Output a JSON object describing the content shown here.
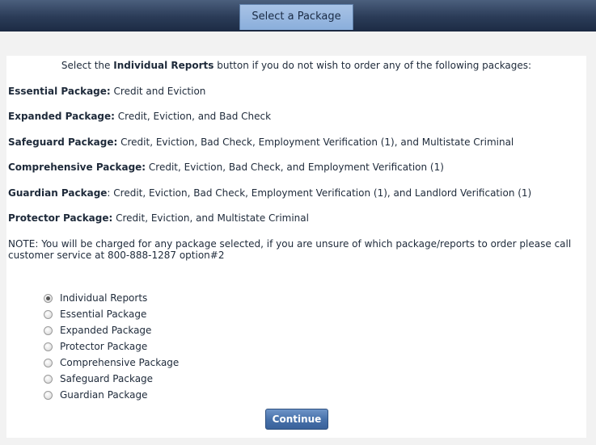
{
  "header": {
    "active_tab": "Select a Package"
  },
  "intro": {
    "prefix": "Select the ",
    "bold": "Individual Reports",
    "suffix": " button if you do not wish to order any of the following packages:"
  },
  "packages": [
    {
      "name": "Essential Package:",
      "desc": " Credit and Eviction"
    },
    {
      "name": "Expanded Package:",
      "desc": " Credit, Eviction, and Bad Check"
    },
    {
      "name": "Safeguard Package:",
      "desc": " Credit, Eviction, Bad Check, Employment Verification (1), and Multistate Criminal"
    },
    {
      "name": "Comprehensive Package:",
      "desc": " Credit, Eviction, Bad Check, and Employment Verification (1)"
    },
    {
      "name": "Guardian Package",
      "desc": ": Credit, Eviction, Bad Check, Employment Verification (1), and Landlord Verification (1)"
    },
    {
      "name": "Protector Package:",
      "desc": " Credit, Eviction, and Multistate Criminal"
    }
  ],
  "note": "NOTE: You will be charged for any package selected, if you are unsure of which package/reports to order please call customer service at 800-888-1287 option#2",
  "options": [
    {
      "label": "Individual Reports",
      "checked": true
    },
    {
      "label": "Essential Package",
      "checked": false
    },
    {
      "label": "Expanded Package",
      "checked": false
    },
    {
      "label": "Protector Package",
      "checked": false
    },
    {
      "label": "Comprehensive Package",
      "checked": false
    },
    {
      "label": "Safeguard Package",
      "checked": false
    },
    {
      "label": "Guardian Package",
      "checked": false
    }
  ],
  "continue_label": "Continue"
}
